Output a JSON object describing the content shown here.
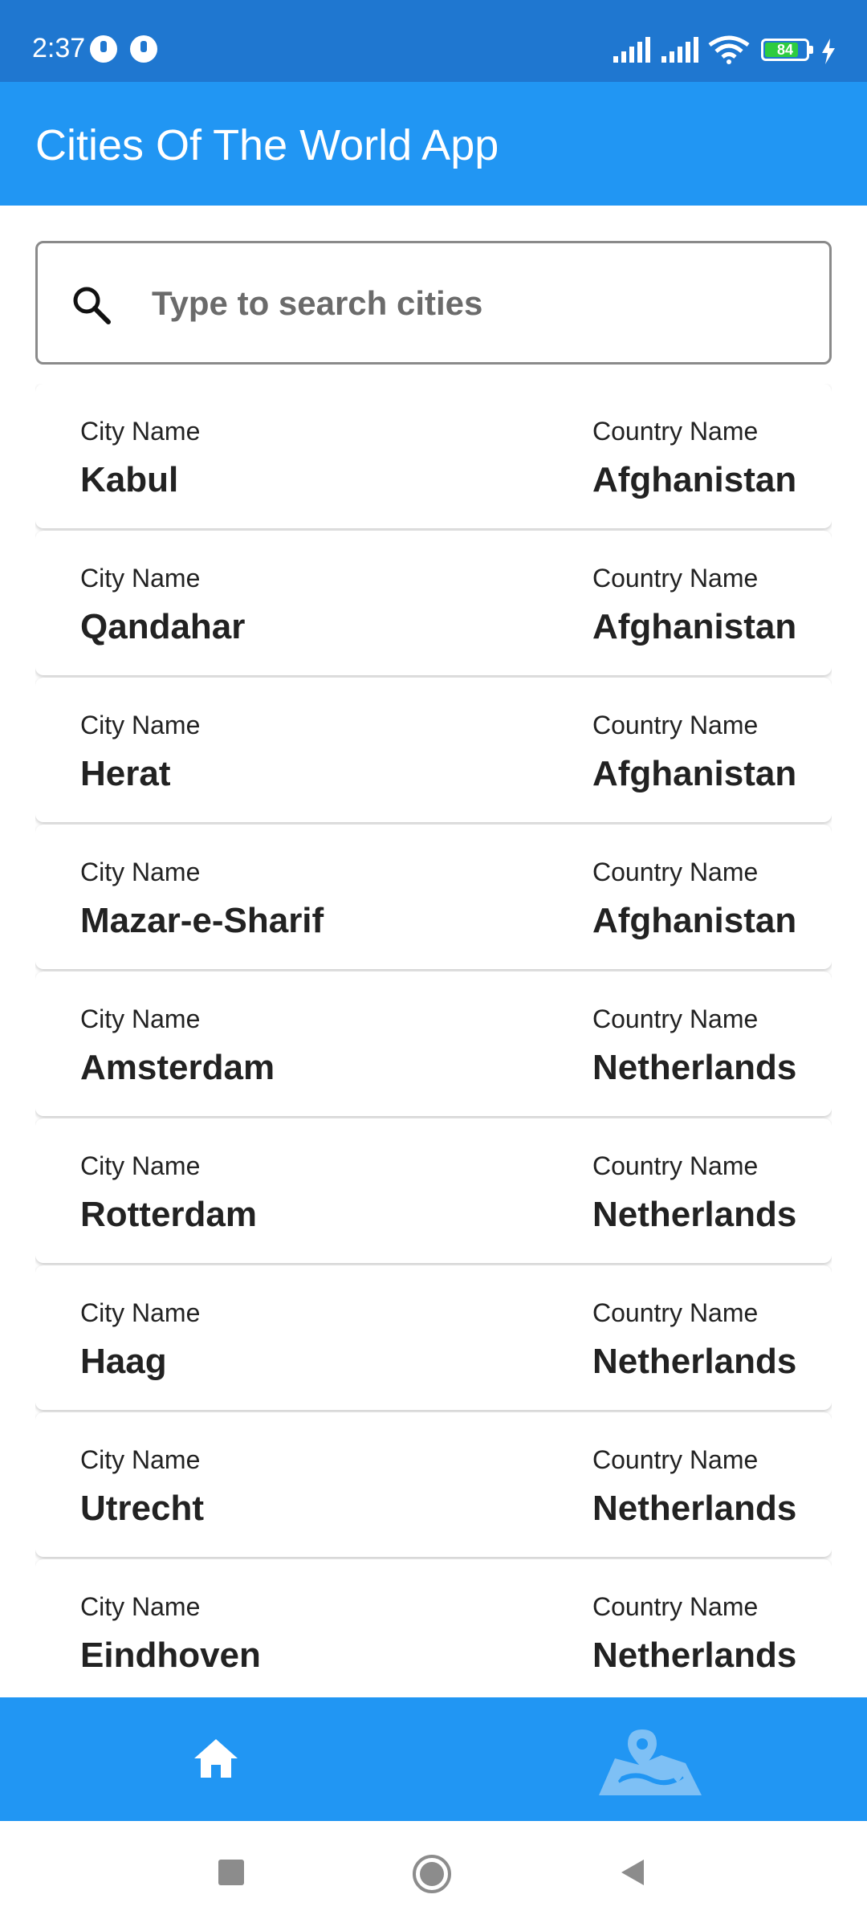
{
  "status_bar": {
    "time": "2:37",
    "battery_level": "84",
    "battery_fraction": 0.84,
    "icons": [
      "notification-icon",
      "notification-icon",
      "signal-icon",
      "signal-icon",
      "wifi-icon",
      "battery-icon",
      "charging-icon"
    ]
  },
  "app_bar": {
    "title": "Cities Of The World App"
  },
  "search": {
    "placeholder": "Type to search cities",
    "value": "",
    "icon": "search-icon"
  },
  "list": {
    "city_label": "City Name",
    "country_label": "Country Name",
    "items": [
      {
        "city": "Kabul",
        "country": "Afghanistan"
      },
      {
        "city": "Qandahar",
        "country": "Afghanistan"
      },
      {
        "city": "Herat",
        "country": "Afghanistan"
      },
      {
        "city": "Mazar-e-Sharif",
        "country": "Afghanistan"
      },
      {
        "city": "Amsterdam",
        "country": "Netherlands"
      },
      {
        "city": "Rotterdam",
        "country": "Netherlands"
      },
      {
        "city": "Haag",
        "country": "Netherlands"
      },
      {
        "city": "Utrecht",
        "country": "Netherlands"
      },
      {
        "city": "Eindhoven",
        "country": "Netherlands"
      }
    ]
  },
  "bottom_nav": {
    "items": [
      {
        "icon": "home-icon",
        "active": true
      },
      {
        "icon": "map-icon",
        "active": false
      }
    ]
  },
  "system_nav": {
    "buttons": [
      "recents-button",
      "home-button",
      "back-button"
    ]
  },
  "colors": {
    "status_bar": "#1f77d0",
    "primary": "#2196f3",
    "card_background": "#ffffff",
    "text": "#222222",
    "battery_fill": "#2ecc40"
  }
}
